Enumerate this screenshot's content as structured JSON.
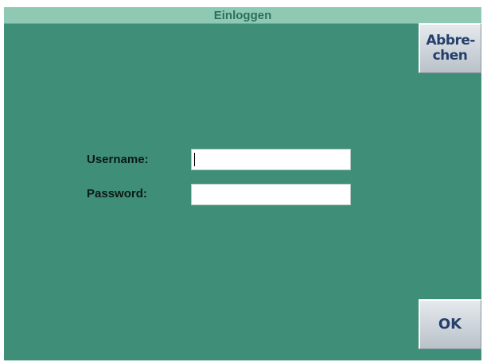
{
  "window": {
    "title": "Einloggen"
  },
  "buttons": {
    "cancel_label": "Abbre-\nchen",
    "ok_label": "OK"
  },
  "form": {
    "username": {
      "label": "Username:",
      "value": ""
    },
    "password": {
      "label": "Password:",
      "value": ""
    }
  },
  "colors": {
    "background": "#3f8e78",
    "title_bar": "#8fc9b4",
    "title_text": "#2c6f5d",
    "button_text": "#243f6b"
  }
}
